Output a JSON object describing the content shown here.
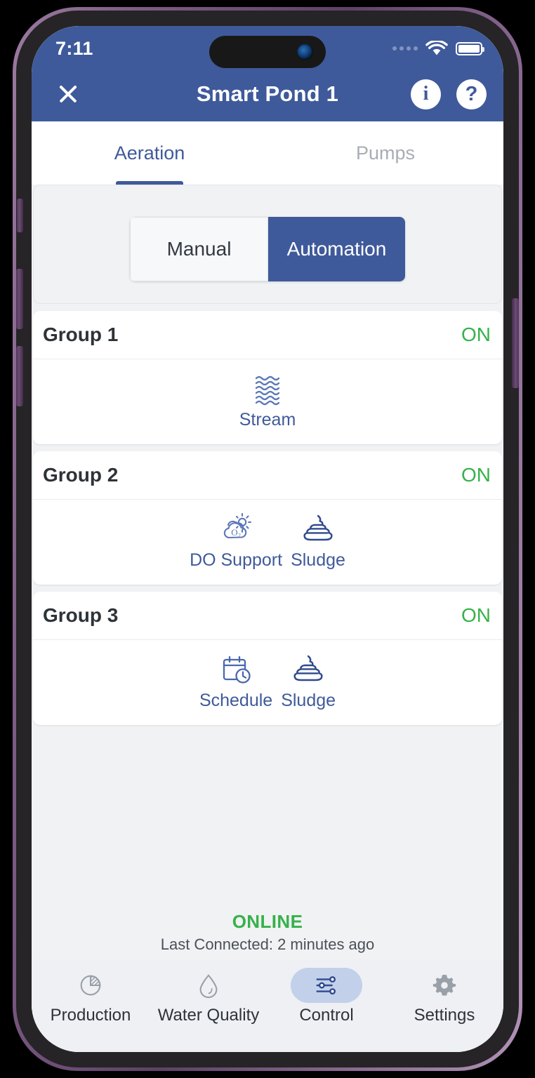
{
  "status_bar": {
    "time": "7:11",
    "cellular_icon": "cellular-dots-icon",
    "wifi_icon": "wifi-icon",
    "battery_icon": "battery-full-icon"
  },
  "app_bar": {
    "close_label": "close-icon",
    "title": "Smart Pond 1",
    "info_label": "i",
    "help_label": "?"
  },
  "tabs": [
    {
      "label": "Aeration",
      "active": true
    },
    {
      "label": "Pumps",
      "active": false
    }
  ],
  "mode_segmented": {
    "manual_label": "Manual",
    "automation_label": "Automation",
    "selected": "Automation"
  },
  "groups": [
    {
      "title": "Group 1",
      "state": "ON",
      "modes": [
        {
          "label": "Stream",
          "icon": "waves-icon"
        }
      ]
    },
    {
      "title": "Group 2",
      "state": "ON",
      "modes": [
        {
          "label": "DO Support",
          "icon": "cloud-sun-o2-icon"
        },
        {
          "label": "Sludge",
          "icon": "sludge-icon"
        }
      ]
    },
    {
      "title": "Group 3",
      "state": "ON",
      "modes": [
        {
          "label": "Schedule",
          "icon": "calendar-clock-icon"
        },
        {
          "label": "Sludge",
          "icon": "sludge-icon"
        }
      ]
    }
  ],
  "connection": {
    "status": "ONLINE",
    "last_connected": "Last Connected:  2 minutes ago"
  },
  "bottom_nav": [
    {
      "label": "Production",
      "icon": "pie-chart-icon",
      "active": false
    },
    {
      "label": "Water Quality",
      "icon": "water-drop-icon",
      "active": false
    },
    {
      "label": "Control",
      "icon": "sliders-icon",
      "active": true
    },
    {
      "label": "Settings",
      "icon": "gear-icon",
      "active": false
    }
  ],
  "colors": {
    "header_blue": "#3f5a9b",
    "accent_blue": "#3f5a9b",
    "status_green": "#36b24a",
    "active_pill": "#c3d0ea",
    "page_bg": "#f1f2f4"
  }
}
